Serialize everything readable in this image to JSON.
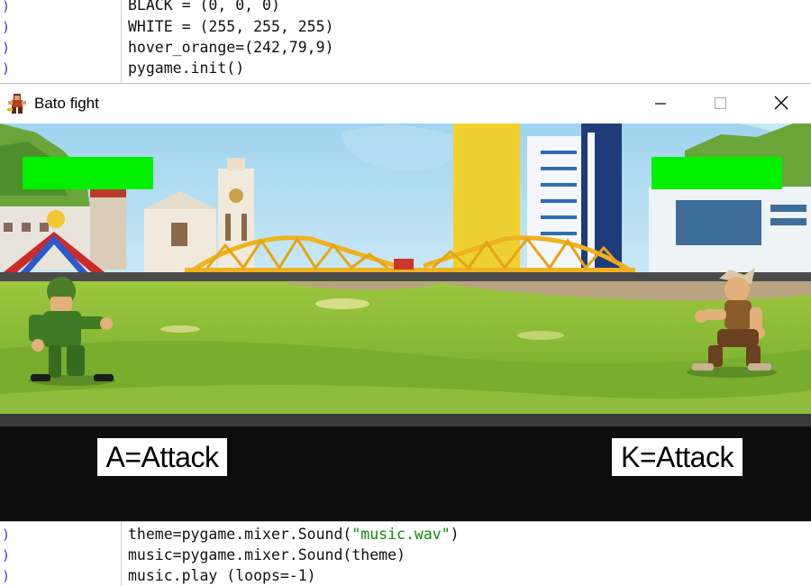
{
  "editor": {
    "top_lines": [
      "BLACK = (0, 0, 0)",
      "WHITE = (255, 255, 255)",
      "hover_orange=(242,79,9)",
      "pygame.init()"
    ],
    "bottom_lines": {
      "line1_prefix": "theme=pygame.mixer.Sound(",
      "line1_string": "\"music.wav\"",
      "line1_suffix": ")",
      "line2": "music=pygame.mixer.Sound(theme)",
      "line3": "music.play (loops=-1)"
    },
    "gutter_marker": ")",
    "colors": {
      "string": "#0c8a0c",
      "gutter_marker": "#3b3bd8"
    }
  },
  "window": {
    "title": "Bato fight",
    "icon": "fighter-sprite-icon",
    "controls": [
      "minimize-icon",
      "maximize-icon",
      "close-icon"
    ]
  },
  "game": {
    "player1": {
      "health": 1.0,
      "control_hint": "A=Attack",
      "character": "green soldier"
    },
    "player2": {
      "health": 1.0,
      "control_hint": "K=Attack",
      "character": "viking warrior"
    },
    "colors": {
      "health": "#00f000",
      "hud_background": "#0d0d0d"
    }
  }
}
